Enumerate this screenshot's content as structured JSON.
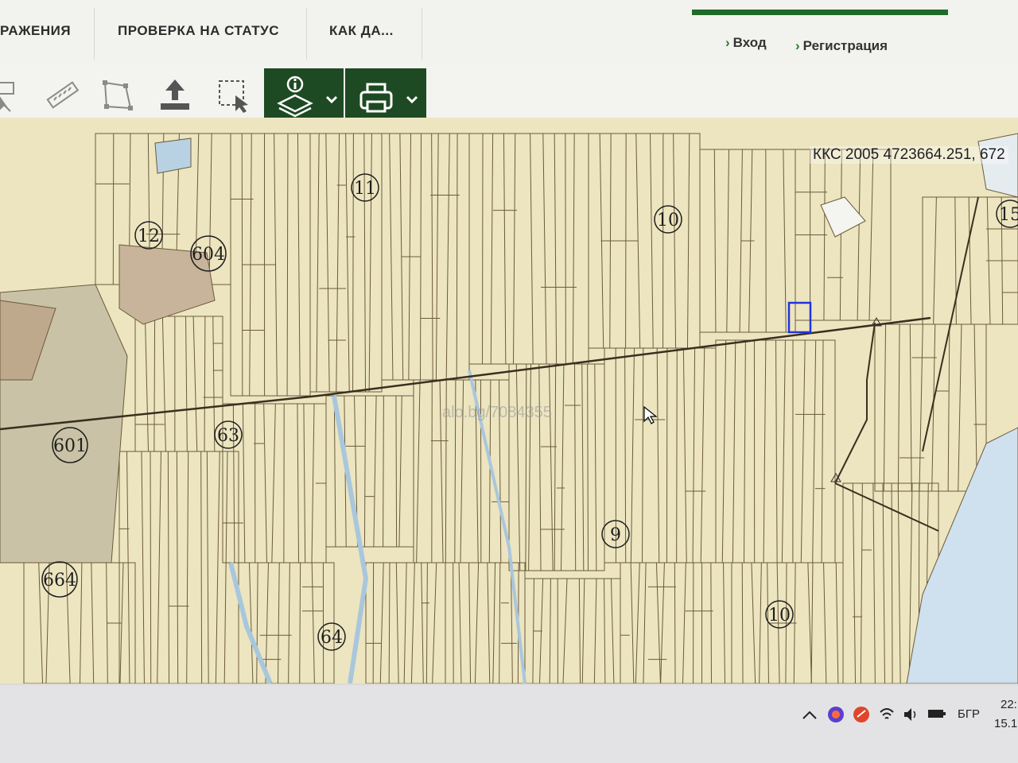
{
  "nav": {
    "tabs": [
      {
        "label": "РАЖЕНИЯ"
      },
      {
        "label": "ПРОВЕРКА НА СТАТУС"
      },
      {
        "label": "КАК ДА..."
      }
    ],
    "login": "Вход",
    "register": "Регистрация"
  },
  "toolbar": {
    "tools": [
      {
        "icon": "select-icon"
      },
      {
        "icon": "ruler-icon"
      },
      {
        "icon": "polygon-icon"
      },
      {
        "icon": "upload-icon"
      },
      {
        "icon": "box-select-icon"
      },
      {
        "icon": "layers-info-icon"
      },
      {
        "icon": "printer-icon"
      }
    ],
    "accent": "#1e4a23"
  },
  "map": {
    "coordinates": "ККС 2005 4723664.251, 672",
    "watermark": "alo.bg/7084355",
    "zone_labels": [
      {
        "text": "11"
      },
      {
        "text": "12"
      },
      {
        "text": "604"
      },
      {
        "text": "10"
      },
      {
        "text": "15"
      },
      {
        "text": "601"
      },
      {
        "text": "63"
      },
      {
        "text": "9"
      },
      {
        "text": "664"
      },
      {
        "text": "64"
      },
      {
        "text": "10"
      }
    ],
    "parcel_fill": "#ece5c0",
    "selection_color": "#2233dd"
  },
  "taskbar": {
    "language": "БГР",
    "time": "22:",
    "date": "15.1"
  }
}
